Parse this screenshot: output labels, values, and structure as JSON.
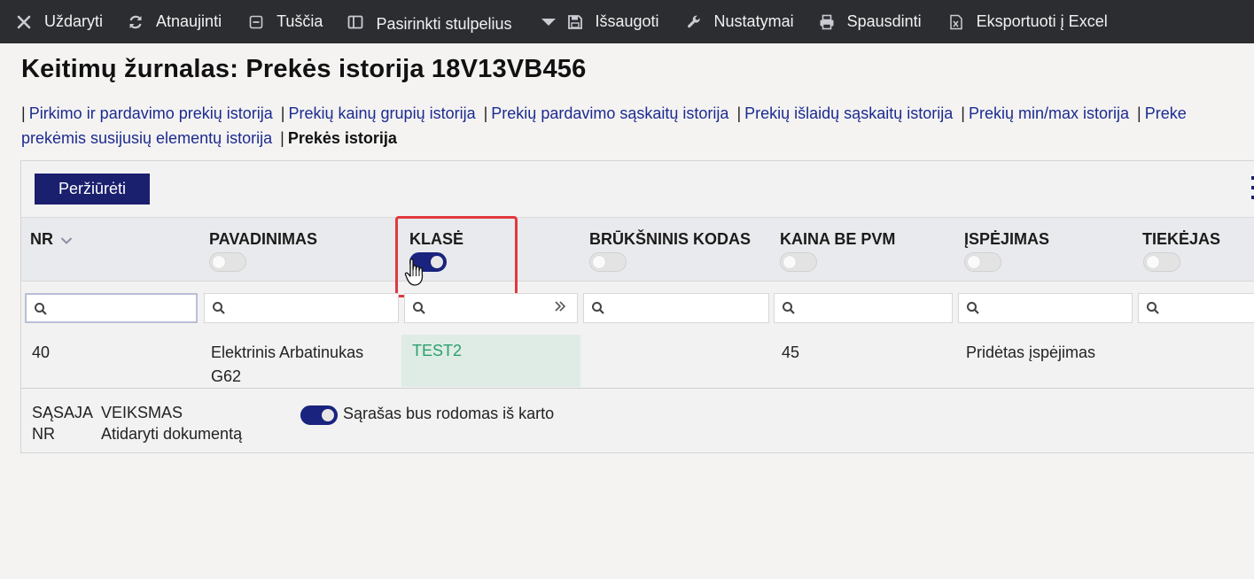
{
  "toolbar": {
    "items": [
      {
        "label": "Uždaryti",
        "icon": "close-icon"
      },
      {
        "label": "Atnaujinti",
        "icon": "refresh-icon"
      },
      {
        "label": "Tuščia",
        "icon": "clear-icon"
      },
      {
        "label": "Pasirinkti stulpelius",
        "icon": "columns-icon"
      },
      {
        "label": "Išsaugoti",
        "icon": "save-icon"
      },
      {
        "label": "Nustatymai",
        "icon": "wrench-icon"
      },
      {
        "label": "Spausdinti",
        "icon": "print-icon"
      },
      {
        "label": "Eksportuoti į Excel",
        "icon": "excel-icon"
      }
    ]
  },
  "page": {
    "title": "Keitimų žurnalas: Prekės istorija 18V13VB456"
  },
  "links": {
    "items": [
      "Pirkimo ir pardavimo prekių istorija",
      "Prekių kainų grupių istorija",
      "Prekių pardavimo sąskaitų istorija",
      "Prekių išlaidų sąskaitų istorija",
      "Prekių min/max istorija",
      "Preke",
      "prekėmis susijusių elementų istorija"
    ],
    "current": "Prekės istorija"
  },
  "panel": {
    "view_label": "Peržiūrėti"
  },
  "columns": [
    {
      "label": "NR",
      "toggle_on": false
    },
    {
      "label": "PAVADINIMAS",
      "toggle_on": false
    },
    {
      "label": "KLASĖ",
      "toggle_on": true
    },
    {
      "label": "BRŪKŠNINIS KODAS",
      "toggle_on": false
    },
    {
      "label": "KAINA BE PVM",
      "toggle_on": false
    },
    {
      "label": "ĮSPĖJIMAS",
      "toggle_on": false
    },
    {
      "label": "TIEKĖJAS",
      "toggle_on": false
    }
  ],
  "row": {
    "nr": "40",
    "name_line1": "Elektrinis Arbatinukas",
    "name_line2": "G62",
    "class": "TEST2",
    "barcode": "",
    "price": "45",
    "warning": "Pridėtas įspėjimas",
    "supplier": ""
  },
  "footer": {
    "link_label_line1": "SĄSAJA",
    "link_label_line2": "NR",
    "action_label": "VEIKSMAS",
    "action_value": "Atidaryti dokumentą",
    "toggle_label": "Sąrašas bus rodomas iš karto",
    "toggle_on": true
  }
}
